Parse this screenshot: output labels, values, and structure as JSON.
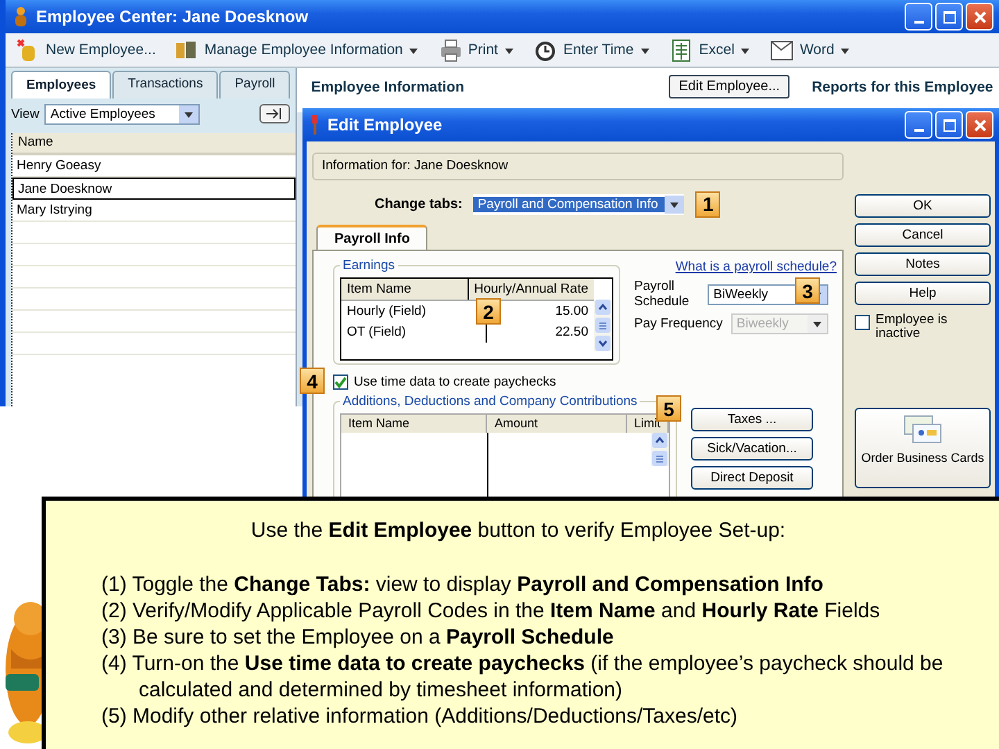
{
  "main_window": {
    "title": "Employee Center: Jane Doesknow",
    "toolbar": [
      {
        "label": "New Employee...",
        "dropdown": false
      },
      {
        "label": "Manage Employee Information",
        "dropdown": true
      },
      {
        "label": "Print",
        "dropdown": true
      },
      {
        "label": "Enter Time",
        "dropdown": true
      },
      {
        "label": "Excel",
        "dropdown": true
      },
      {
        "label": "Word",
        "dropdown": true
      }
    ],
    "tabs": [
      {
        "label": "Employees",
        "selected": true
      },
      {
        "label": "Transactions",
        "selected": false
      },
      {
        "label": "Payroll",
        "selected": false
      }
    ],
    "view_label": "View",
    "view_value": "Active Employees",
    "list": {
      "column": "Name",
      "rows": [
        {
          "name": "Henry Goeasy",
          "selected": false
        },
        {
          "name": "Jane Doesknow",
          "selected": true
        },
        {
          "name": "Mary Istrying",
          "selected": false
        }
      ]
    },
    "info_title": "Employee Information",
    "edit_button": "Edit Employee...",
    "reports_title": "Reports for this Employee"
  },
  "dialog": {
    "title": "Edit Employee",
    "info": "Information for: Jane Doesknow",
    "change_tabs": {
      "label": "Change tabs:",
      "value": "Payroll and Compensation Info",
      "marker": "1"
    },
    "tab": "Payroll Info",
    "earnings": {
      "title": "Earnings",
      "marker": "2",
      "columns": [
        "Item Name",
        "Hourly/Annual Rate"
      ],
      "rows": [
        {
          "item": "Hourly (Field)",
          "rate": "15.00"
        },
        {
          "item": "OT (Field)",
          "rate": "22.50"
        }
      ]
    },
    "schedule_link": "What is a payroll schedule?",
    "payroll_schedule": {
      "label": "Payroll Schedule",
      "value": "BiWeekly",
      "marker": "3"
    },
    "pay_frequency": {
      "label": "Pay Frequency",
      "value": "Biweekly",
      "disabled": true
    },
    "use_time_data": {
      "label": "Use time data to create paychecks",
      "checked": true,
      "marker": "4"
    },
    "additions": {
      "title": "Additions, Deductions and Company Contributions",
      "marker": "5",
      "columns": [
        "Item Name",
        "Amount",
        "Limit"
      ]
    },
    "side_buttons": [
      "Taxes ...",
      "Sick/Vacation...",
      "Direct Deposit"
    ],
    "buttons": [
      "OK",
      "Cancel",
      "Notes",
      "Help"
    ],
    "inactive": {
      "label": "Employee is inactive",
      "checked": false
    },
    "cards_button": "Order Business Cards"
  },
  "callout": {
    "heading": "Use the **Edit Employee** button to verify Employee Set-up:",
    "items": [
      "(1) Toggle the **Change Tabs:** view to display **Payroll and Compensation Info**",
      "(2) Verify/Modify Applicable Payroll Codes in the **Item Name** and **Hourly Rate** Fields",
      "(3) Be sure to set the Employee on a **Payroll Schedule**",
      "(4) Turn-on the **Use time data to create paychecks** (if the employee’s paycheck should be calculated and determined by timesheet information)",
      "(5) Modify other relative information (Additions/Deductions/Taxes/etc)"
    ]
  }
}
